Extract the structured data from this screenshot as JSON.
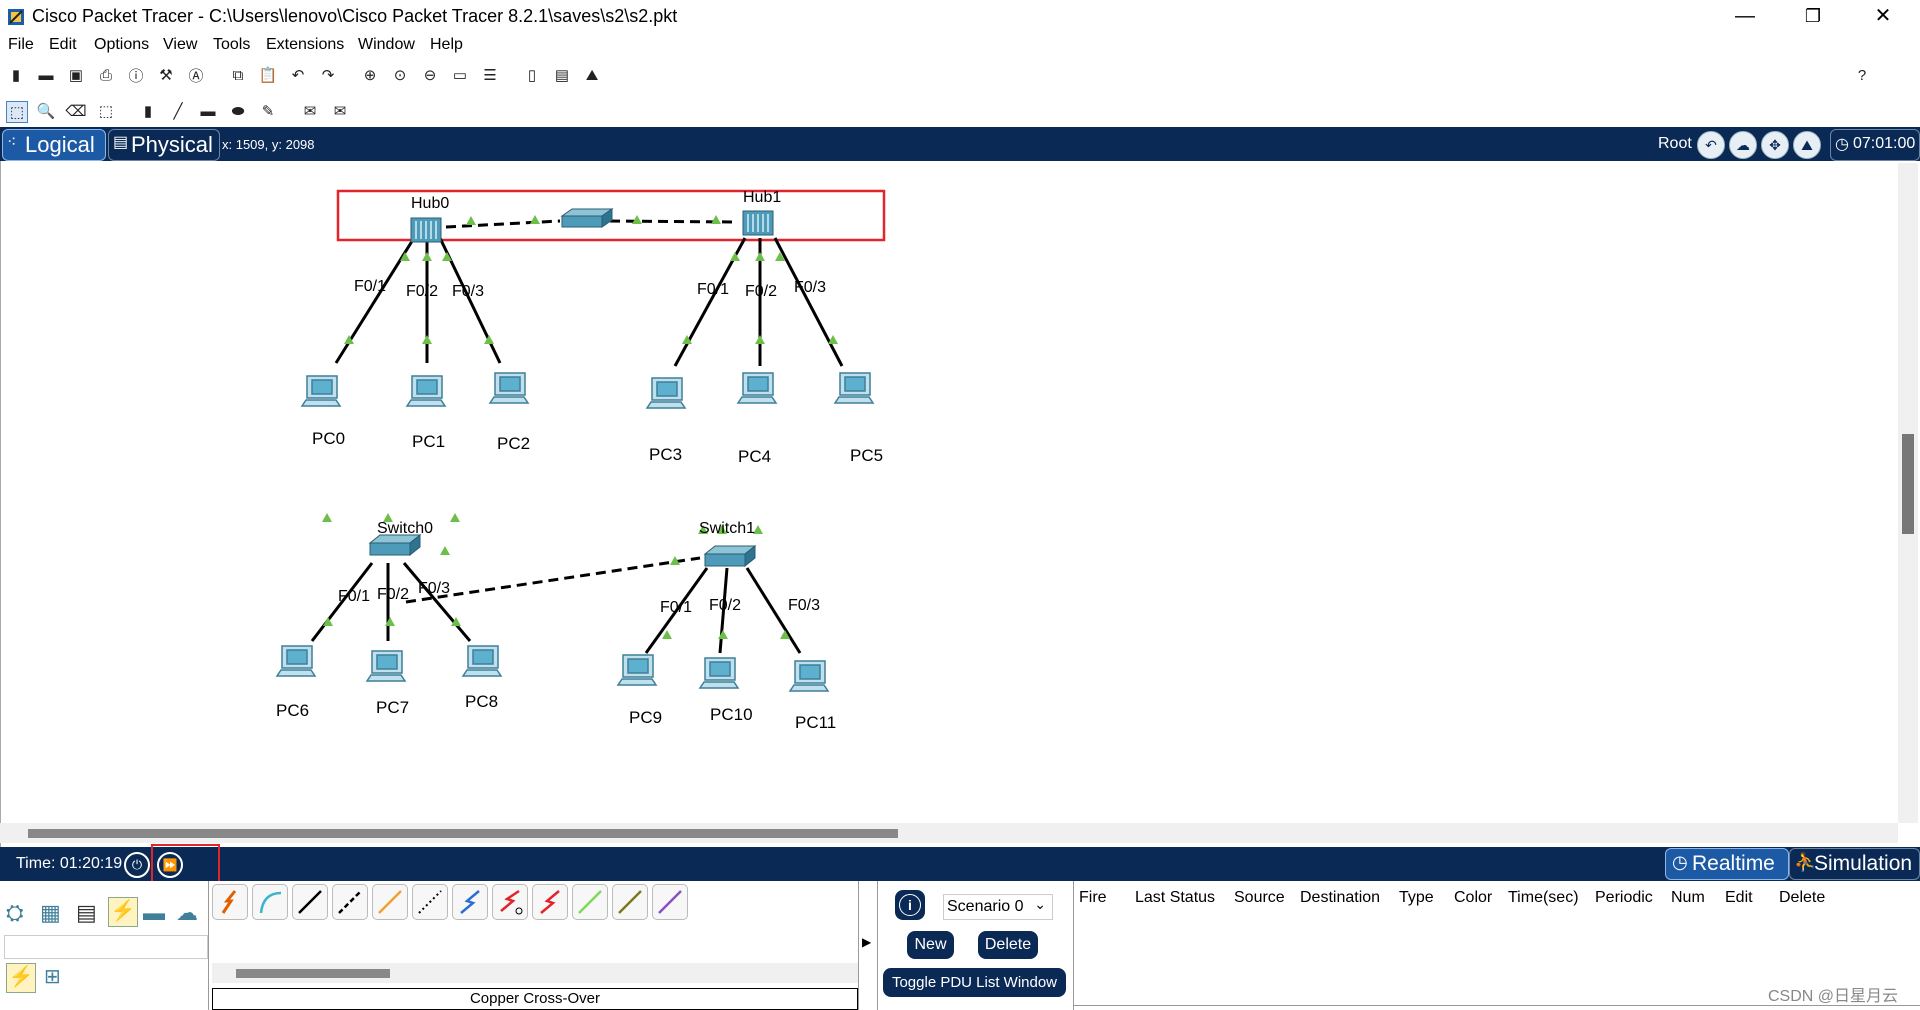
{
  "window": {
    "title": "Cisco Packet Tracer - C:\\Users\\lenovo\\Cisco Packet Tracer 8.2.1\\saves\\s2\\s2.pkt",
    "minimize": "—",
    "maximize": "❐",
    "close": "✕"
  },
  "menu": [
    "File",
    "Edit",
    "Options",
    "View",
    "Tools",
    "Extensions",
    "Window",
    "Help"
  ],
  "help_glyph": "?",
  "logical_bar": {
    "logical_label": "Logical",
    "physical_label": "Physical",
    "coords": "x: 1509, y: 2098",
    "root_label": "Root",
    "clock": "07:01:00"
  },
  "topology": {
    "hubs": [
      {
        "name": "Hub0"
      },
      {
        "name": "Hub1"
      }
    ],
    "switches": [
      {
        "name": "Switch0"
      },
      {
        "name": "Switch1"
      }
    ],
    "pcs": [
      "PC0",
      "PC1",
      "PC2",
      "PC3",
      "PC4",
      "PC5",
      "PC6",
      "PC7",
      "PC8",
      "PC9",
      "PC10",
      "PC11"
    ],
    "ports": [
      "F0/1",
      "F0/2",
      "F0/3",
      "F0/1",
      "F0/2",
      "F0/3",
      "F0/1",
      "F0/2",
      "F0/3",
      "F0/1",
      "F0/2",
      "F0/3"
    ]
  },
  "timebar": {
    "time": "Time: 01:20:19",
    "realtime_label": "Realtime",
    "simulation_label": "Simulation"
  },
  "bottom": {
    "connection_name": "Copper Cross-Over",
    "scenario": "Scenario 0",
    "new_label": "New",
    "delete_label": "Delete",
    "toggle_label": "Toggle PDU List Window",
    "pdu_columns": [
      "Fire",
      "Last Status",
      "Source",
      "Destination",
      "Type",
      "Color",
      "Time(sec)",
      "Periodic",
      "Num",
      "Edit",
      "Delete"
    ],
    "watermark": "CSDN @日星月云"
  },
  "colors": {
    "accent": "#0a2a55",
    "highlight_red": "#e0252b",
    "link_green": "#6cc04a"
  }
}
